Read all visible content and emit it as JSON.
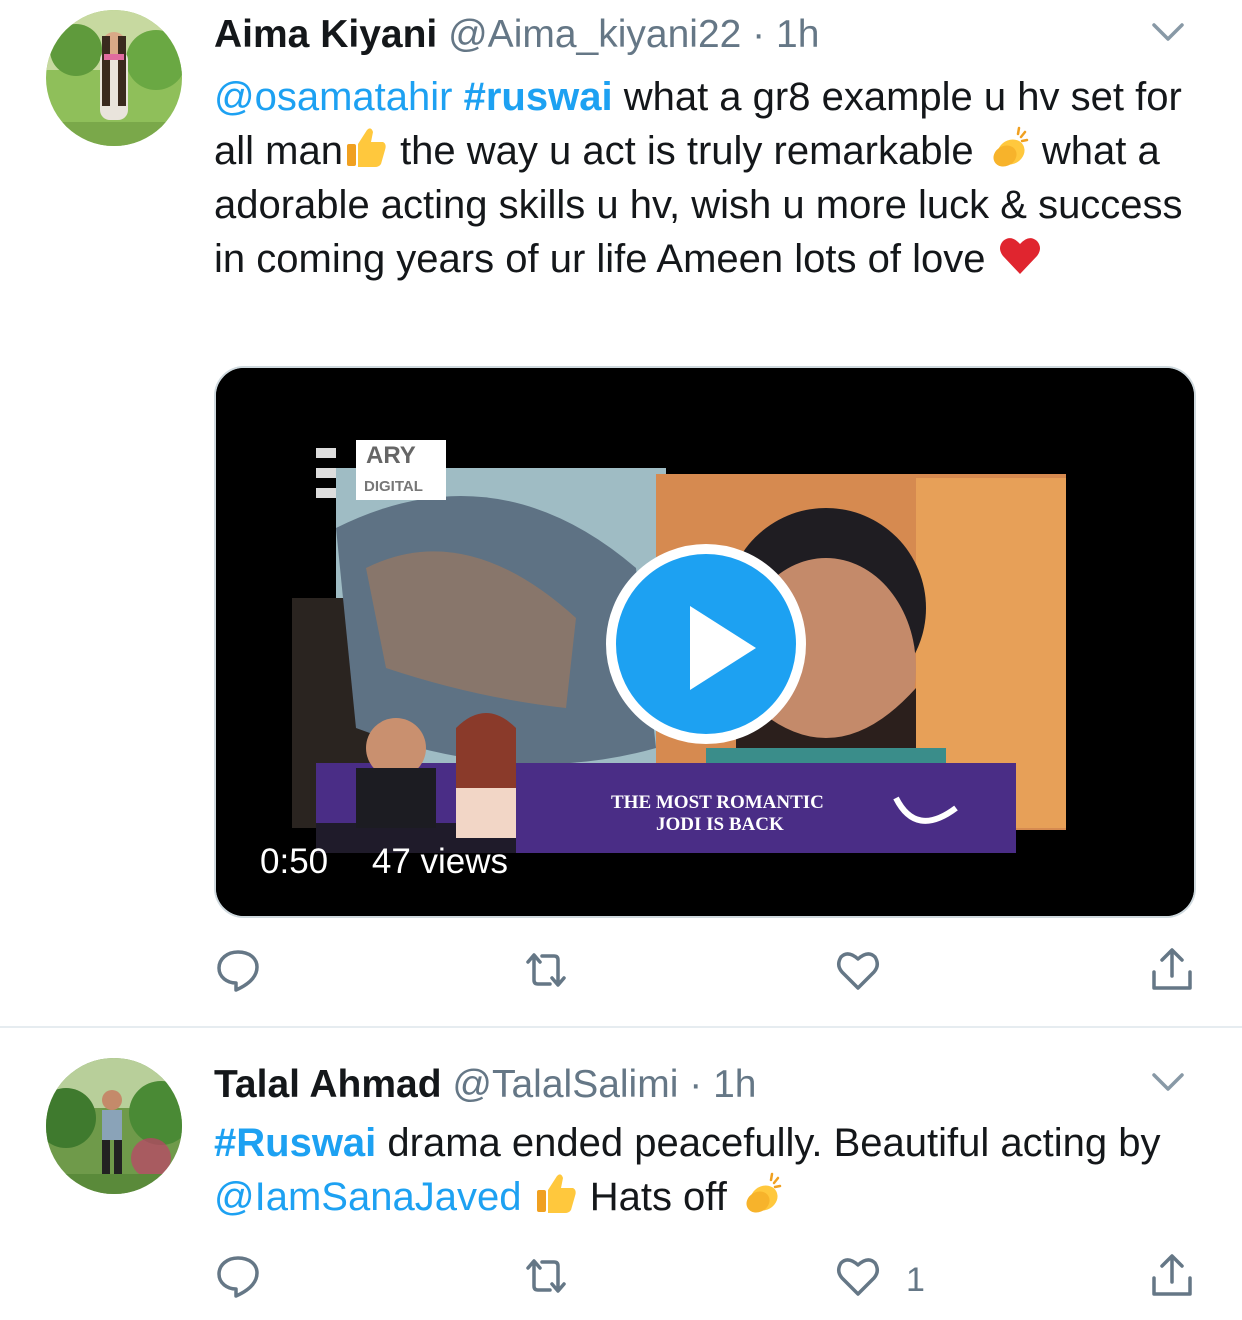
{
  "tweets": [
    {
      "name": "Aima Kiyani",
      "handle": "@Aima_kiyani22",
      "separator": "·",
      "time": "1h",
      "body": {
        "p1_mention": "@osamatahir",
        "p2_hashtag": "#ruswai",
        "p3_text": " what a gr8 example u hv set for all man",
        "emoji1": "thumbs-up-emoji",
        "p4_text": " the way u act is truly remarkable ",
        "emoji2": "clapping-hands-emoji",
        "p5_text": " what a adorable acting skills u hv, wish u more luck & success in coming years of ur life Ameen lots of love ",
        "emoji3": "red-heart-emoji"
      },
      "video": {
        "duration": "0:50",
        "views": "47 views",
        "overlay_logo": "ARY",
        "overlay_logo_sub": "DIGITAL",
        "banner_line1": "THE MOST ROMANTIC",
        "banner_line2": "JODI IS BACK"
      },
      "actions": {
        "reply": "",
        "retweet": "",
        "like": "",
        "share": ""
      }
    },
    {
      "name": "Talal Ahmad",
      "handle": "@TalalSalimi",
      "separator": "·",
      "time": "1h",
      "body": {
        "p1_hashtag": "#Ruswai",
        "p2_text": " drama ended peacefully. Beautiful acting by ",
        "p3_mention": "@IamSanaJaved",
        "emoji1": "thumbs-up-emoji",
        "p4_text": " Hats off ",
        "emoji2": "clapping-hands-emoji"
      },
      "actions": {
        "reply": "",
        "retweet": "",
        "like": "1",
        "share": ""
      }
    }
  ],
  "colors": {
    "link": "#1da1f2",
    "muted": "#657786",
    "text": "#14171a",
    "divider": "#e6ecf0"
  }
}
